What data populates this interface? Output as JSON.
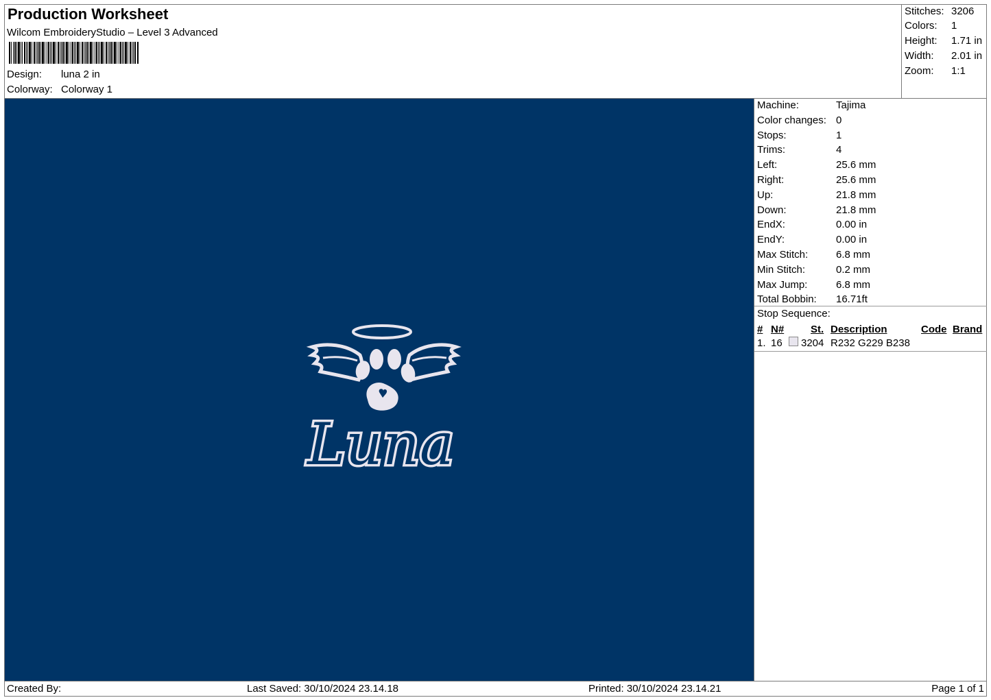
{
  "header": {
    "title": "Production Worksheet",
    "subtitle": "Wilcom EmbroideryStudio – Level 3 Advanced",
    "design_label": "Design:",
    "design_value": "luna 2 in",
    "colorway_label": "Colorway:",
    "colorway_value": "Colorway 1"
  },
  "summary": {
    "stitches_label": "Stitches:",
    "stitches_value": "3206",
    "colors_label": "Colors:",
    "colors_value": "1",
    "height_label": "Height:",
    "height_value": "1.71 in",
    "width_label": "Width:",
    "width_value": "2.01 in",
    "zoom_label": "Zoom:",
    "zoom_value": "1:1"
  },
  "preview": {
    "background_color": "#003466",
    "thread_color": "#e8e5ee",
    "design_text": "Luna"
  },
  "machine_info": [
    {
      "label": "Machine:",
      "value": "Tajima"
    },
    {
      "label": "Color changes:",
      "value": "0"
    },
    {
      "label": "Stops:",
      "value": "1"
    },
    {
      "label": "Trims:",
      "value": "4"
    },
    {
      "label": "Left:",
      "value": "25.6 mm"
    },
    {
      "label": "Right:",
      "value": "25.6 mm"
    },
    {
      "label": "Up:",
      "value": "21.8 mm"
    },
    {
      "label": "Down:",
      "value": "21.8 mm"
    },
    {
      "label": "EndX:",
      "value": "0.00 in"
    },
    {
      "label": "EndY:",
      "value": "0.00 in"
    },
    {
      "label": "Max Stitch:",
      "value": "6.8 mm"
    },
    {
      "label": "Min Stitch:",
      "value": "0.2 mm"
    },
    {
      "label": "Max Jump:",
      "value": "6.8 mm"
    },
    {
      "label": "Total Bobbin:",
      "value": "16.71ft"
    }
  ],
  "stop_sequence": {
    "title": "Stop Sequence:",
    "columns": [
      "#",
      "N#",
      "St.",
      "Description",
      "Code",
      "Brand"
    ],
    "rows": [
      {
        "num": "1.",
        "needle": "16",
        "stitches": "3204",
        "description": "R232 G229 B238",
        "code": "",
        "brand": "",
        "swatch_color": "#e8e5ee"
      }
    ]
  },
  "footer": {
    "created_by": "Created By:",
    "last_saved": "Last Saved: 30/10/2024 23.14.18",
    "printed": "Printed: 30/10/2024 23.14.21",
    "page": "Page 1 of 1"
  }
}
